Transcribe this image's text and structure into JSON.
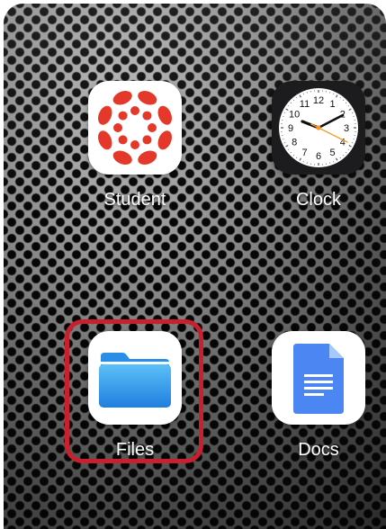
{
  "home_screen": {
    "apps": [
      {
        "label": "Student",
        "icon": "canvas-student-icon"
      },
      {
        "label": "Clock",
        "icon": "clock-icon"
      },
      {
        "label": "Files",
        "icon": "folder-icon"
      },
      {
        "label": "Docs",
        "icon": "google-docs-icon"
      }
    ],
    "clock_numerals": [
      "12",
      "1",
      "2",
      "3",
      "4",
      "5",
      "6",
      "7",
      "8",
      "9",
      "10",
      "11"
    ]
  },
  "colors": {
    "canvas_red": "#e4382b",
    "files_blue": "#2b95e9",
    "docs_blue": "#4b86f2",
    "highlight_red": "#c8202f",
    "clock_second_hand": "#f39a28"
  }
}
